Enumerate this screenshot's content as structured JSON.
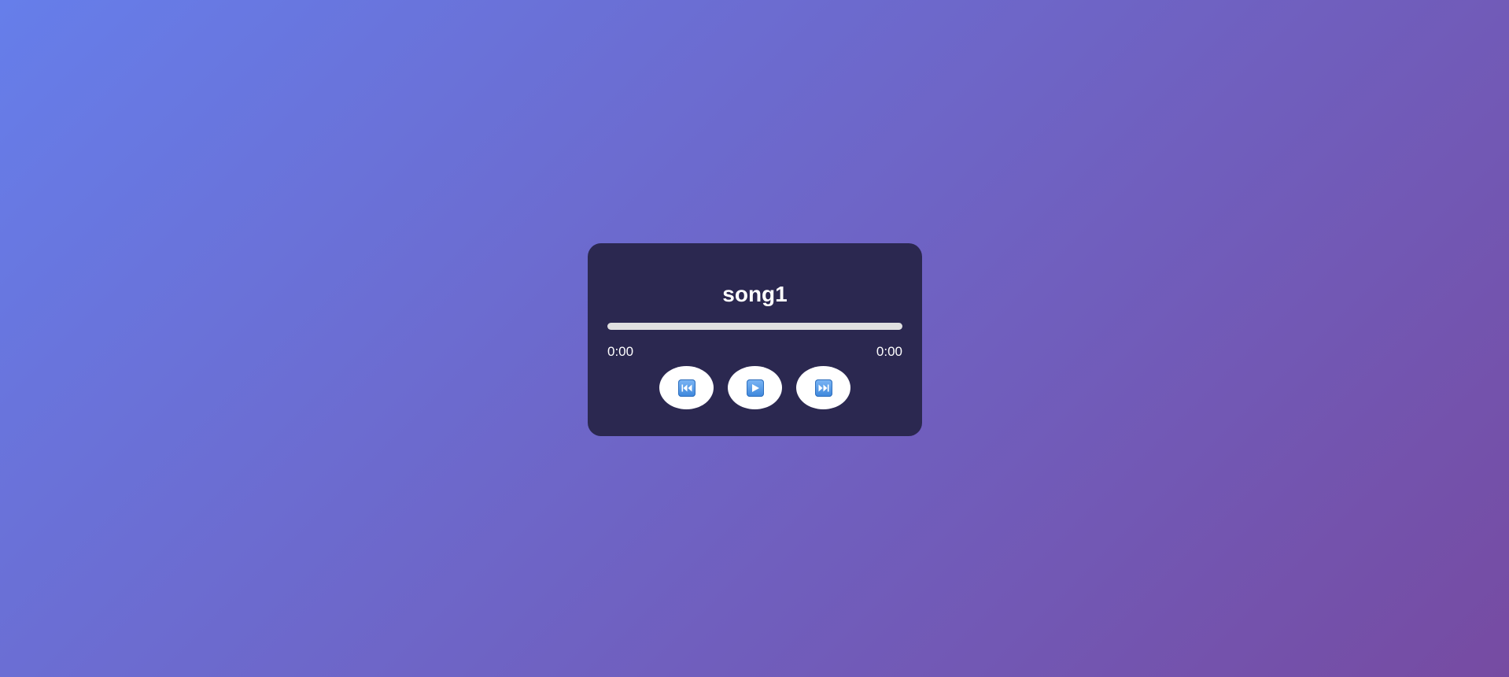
{
  "player": {
    "song_title": "song1",
    "progress_fraction": 0,
    "current_time": "0:00",
    "duration": "0:00"
  },
  "controls": [
    {
      "name": "previous",
      "icon": "previous-track-icon"
    },
    {
      "name": "play",
      "icon": "play-icon"
    },
    {
      "name": "next",
      "icon": "next-track-icon"
    }
  ],
  "colors": {
    "background_start": "#667eea",
    "background_end": "#764ba2",
    "card": "#2b2850",
    "progress_track": "#e0e0e0",
    "icon_blue": "#3c86db"
  }
}
